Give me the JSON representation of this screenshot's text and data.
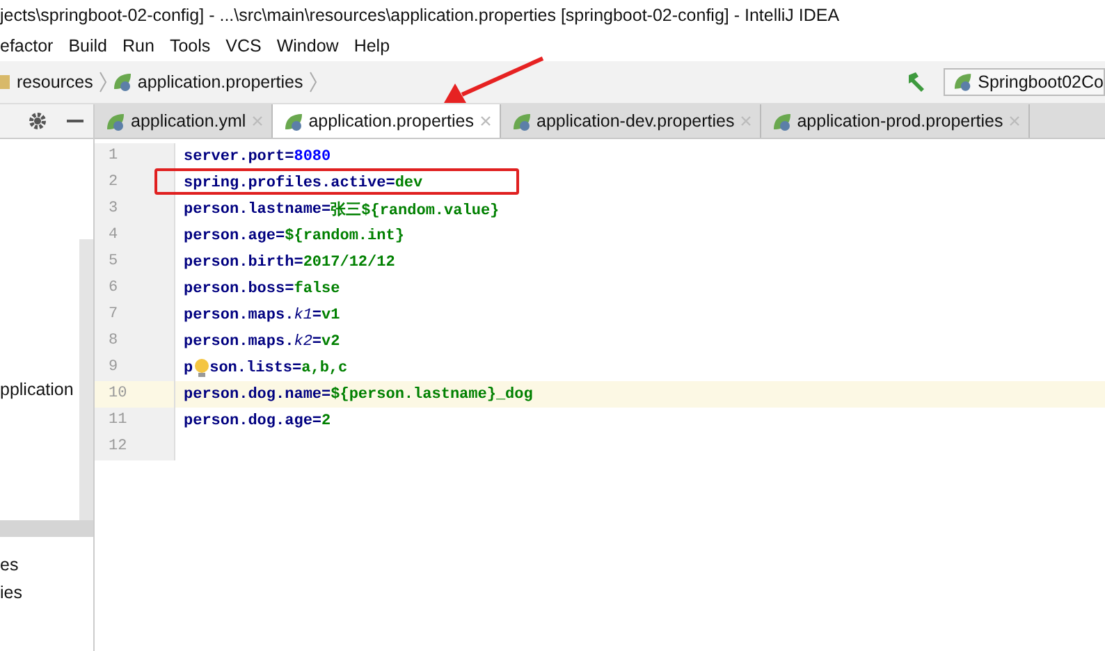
{
  "window": {
    "title": "jects\\springboot-02-config] - ...\\src\\main\\resources\\application.properties [springboot-02-config] - IntelliJ IDEA"
  },
  "menu": [
    "efactor",
    "Build",
    "Run",
    "Tools",
    "VCS",
    "Window",
    "Help"
  ],
  "breadcrumb": [
    "resources",
    "application.properties"
  ],
  "run_config": "Springboot02Co",
  "tabs": [
    {
      "label": "application.yml",
      "selected": false
    },
    {
      "label": "application.properties",
      "selected": true
    },
    {
      "label": "application-dev.properties",
      "selected": false
    },
    {
      "label": "application-prod.properties",
      "selected": false
    }
  ],
  "project_panel": {
    "items": [
      {
        "label": "pplication",
        "selected": false
      },
      {
        "selected": true
      },
      {
        "label": "es",
        "selected": false
      },
      {
        "label": "ies",
        "selected": false
      }
    ]
  },
  "editor": {
    "lines": [
      {
        "number": "1",
        "current": false,
        "segments": [
          {
            "kind": "key",
            "text": "server.port="
          },
          {
            "kind": "num",
            "text": "8080"
          }
        ]
      },
      {
        "number": "2",
        "current": false,
        "segments": [
          {
            "kind": "key",
            "text": "spring.profiles.active="
          },
          {
            "kind": "value",
            "text": "dev"
          }
        ]
      },
      {
        "number": "3",
        "current": false,
        "segments": [
          {
            "kind": "key",
            "text": "person.lastname="
          },
          {
            "kind": "value",
            "text": "张三${random.value}"
          }
        ]
      },
      {
        "number": "4",
        "current": false,
        "segments": [
          {
            "kind": "key",
            "text": "person.age="
          },
          {
            "kind": "value",
            "text": "${random.int}"
          }
        ]
      },
      {
        "number": "5",
        "current": false,
        "segments": [
          {
            "kind": "key",
            "text": "person.birth="
          },
          {
            "kind": "value",
            "text": "2017/12/12"
          }
        ]
      },
      {
        "number": "6",
        "current": false,
        "segments": [
          {
            "kind": "key",
            "text": "person.boss="
          },
          {
            "kind": "value",
            "text": "false"
          }
        ]
      },
      {
        "number": "7",
        "current": false,
        "segments": [
          {
            "kind": "key",
            "text": "person.maps."
          },
          {
            "kind": "italic",
            "text": "k1"
          },
          {
            "kind": "key",
            "text": "="
          },
          {
            "kind": "value",
            "text": "v1"
          }
        ]
      },
      {
        "number": "8",
        "current": false,
        "segments": [
          {
            "kind": "key",
            "text": "person.maps."
          },
          {
            "kind": "italic",
            "text": "k2"
          },
          {
            "kind": "key",
            "text": "="
          },
          {
            "kind": "value",
            "text": "v2"
          }
        ]
      },
      {
        "number": "9",
        "current": false,
        "segments": [
          {
            "kind": "key",
            "text": "p"
          },
          {
            "kind": "bulb"
          },
          {
            "kind": "key",
            "text": "son.lists="
          },
          {
            "kind": "value",
            "text": "a,b,c"
          }
        ]
      },
      {
        "number": "10",
        "current": true,
        "segments": [
          {
            "kind": "key",
            "text": "person.dog.name="
          },
          {
            "kind": "value",
            "text": "${person.lastname}_dog"
          }
        ]
      },
      {
        "number": "11",
        "current": false,
        "segments": [
          {
            "kind": "key",
            "text": "person.dog.age="
          },
          {
            "kind": "value",
            "text": "2"
          }
        ]
      },
      {
        "number": "12",
        "current": false
      }
    ]
  }
}
